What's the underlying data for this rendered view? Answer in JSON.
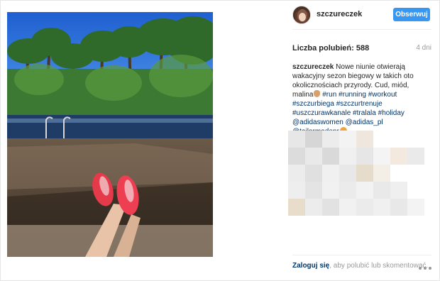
{
  "post": {
    "username": "szczureczek",
    "follow_label": "Obserwuj",
    "likes_label": "Liczba polubień:",
    "likes_count": "588",
    "time_ago": "4 dni",
    "caption": {
      "author": "szczureczek",
      "text_1": "Nowe niunie otwierają wakacyjny sezon biegowy w takich oto okolicznościach przyrody. Cud, miód, malina",
      "tags": [
        "#run",
        "#running",
        "#workout",
        "#szczurbiega",
        "#szczurtrenuje",
        "#uszczurawkanale",
        "#tralala",
        "#holiday",
        "@adidaswomen",
        "@adidas_pl",
        "@tailormadepr"
      ]
    },
    "footer": {
      "login_link": "Zaloguj się",
      "rest": ", aby polubić lub skomentować."
    }
  },
  "icons": {
    "avatar": "avatar",
    "more": "more-options-icon",
    "hand_emoji": "ok-hand-emoji",
    "cat_emoji": "cat-face-emoji"
  },
  "colors": {
    "follow_button": "#3897f0",
    "link": "#003569",
    "muted": "#999999"
  }
}
